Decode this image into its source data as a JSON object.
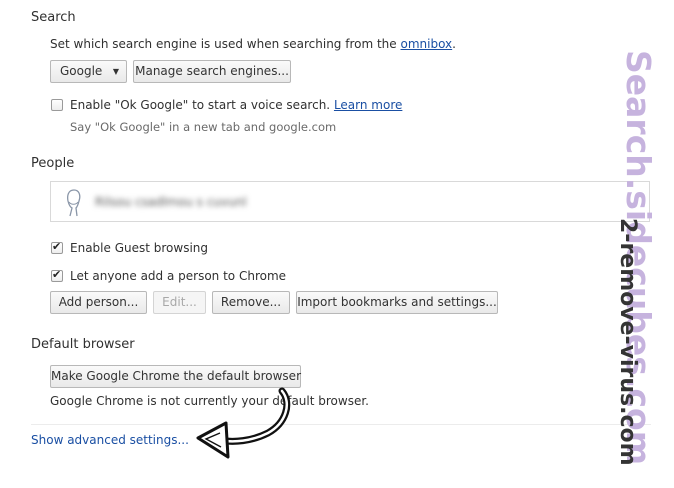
{
  "search": {
    "heading": "Search",
    "description_prefix": "Set which search engine is used when searching from the",
    "omnibox_link": "omnibox",
    "description_suffix": ".",
    "engine_selected": "Google",
    "manage_button": "Manage search engines...",
    "ok_google_label": "Enable \"Ok Google\" to start a voice search.",
    "learn_more_link": "Learn more",
    "ok_google_checked": false,
    "ok_google_hint": "Say \"Ok Google\" in a new tab and google.com"
  },
  "people": {
    "heading": "People",
    "profile_name": "Rilsou csadlmou s cuvunl",
    "guest_label": "Enable Guest browsing",
    "guest_checked": true,
    "add_anyone_label": "Let anyone add a person to Chrome",
    "add_anyone_checked": true,
    "buttons": {
      "add": "Add person...",
      "edit": "Edit...",
      "remove": "Remove...",
      "import": "Import bookmarks and settings..."
    }
  },
  "default_browser": {
    "heading": "Default browser",
    "make_default_button": "Make Google Chrome the default browser",
    "status": "Google Chrome is not currently your default browser."
  },
  "advanced_link": "Show advanced settings...",
  "watermarks": {
    "primary": "Search.sidecubes.com",
    "secondary": "2-remove-virus.com"
  },
  "colors": {
    "link": "#1a4fa3",
    "watermark_primary": "#c6b3de",
    "watermark_secondary": "#343434"
  }
}
